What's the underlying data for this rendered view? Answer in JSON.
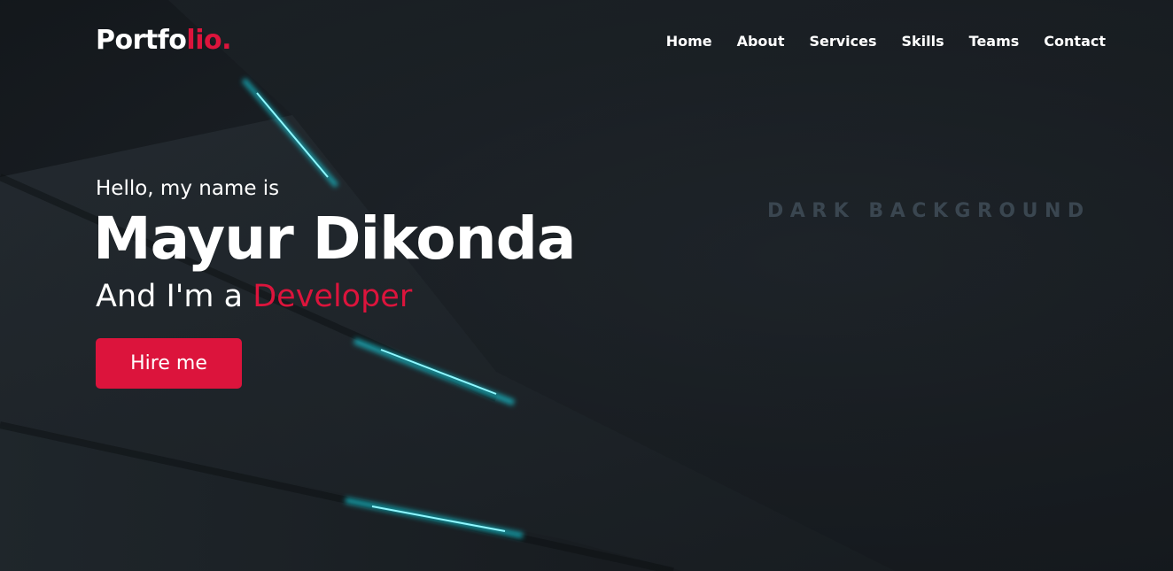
{
  "brand": {
    "logo_main": "Portfo",
    "logo_accent": "lio."
  },
  "nav": {
    "items": [
      {
        "label": "Home"
      },
      {
        "label": "About"
      },
      {
        "label": "Services"
      },
      {
        "label": "Skills"
      },
      {
        "label": "Teams"
      },
      {
        "label": "Contact"
      }
    ]
  },
  "hero": {
    "greeting": "Hello, my name is",
    "name": "Mayur Dikonda",
    "role_prefix": "And I'm a ",
    "role_highlight": "Developer",
    "cta_label": "Hire me"
  },
  "background": {
    "watermark": "DARK BACKGROUND"
  },
  "colors": {
    "accent": "#dc143c",
    "glow": "#19e6f5",
    "background": "#1a1f24",
    "text": "#ffffff"
  }
}
